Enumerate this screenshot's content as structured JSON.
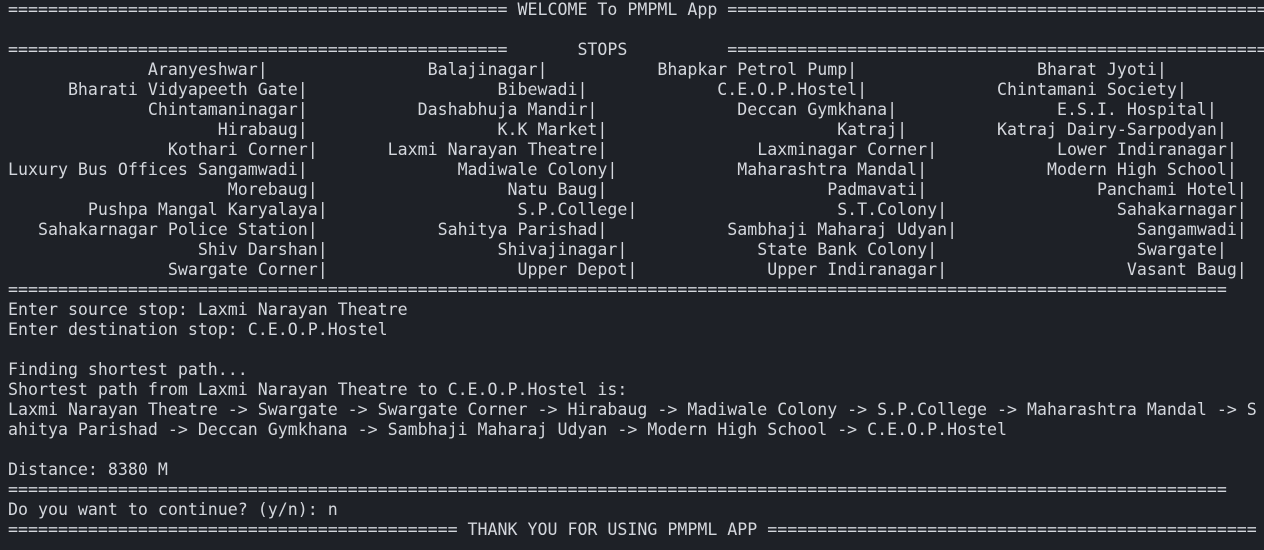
{
  "header": {
    "welcome_banner": "================================================== WELCOME To PMPML App ======================================================",
    "stops_banner": "==================================================       STOPS          ======================================================"
  },
  "stops": {
    "rows": [
      "              Aranyeshwar|                Balajinagar|           Bhapkar Petrol Pump|                  Bharat Jyoti|",
      "      Bharati Vidyapeeth Gate|                   Bibewadi|             C.E.O.P.Hostel|             Chintamani Society|",
      "              Chintamaninagar|           Dashabhuja Mandir|              Deccan Gymkhana|                E.S.I. Hospital|",
      "                     Hirabaug|                   K.K Market|                       Katraj|         Katraj Dairy-Sarpodyan|",
      "                Kothari Corner|       Laxmi Narayan Theatre|               Laxminagar Corner|            Lower Indiranagar|",
      "Luxury Bus Offices Sangamwadi|               Madiwale Colony|            Maharashtra Mandal|            Modern High School|",
      "                      Morebaug|                   Natu Baug|                      Padmavati|                 Panchami Hotel|",
      "        Pushpa Mangal Karyalaya|                   S.P.College|                    S.T.Colony|                 Sahakarnagar|",
      "   Sahakarnagar Police Station|            Sahitya Parishad|            Sambhaji Maharaj Udyan|                  Sangamwadi|",
      "                   Shiv Darshan|                 Shivajinagar|             State Bank Colony|                    Swargate|",
      "                Swargate Corner|                   Upper Depot|             Upper Indiranagar|                  Vasant Baug|"
    ],
    "footer_rule": "=========================================================================================================================="
  },
  "session": {
    "source_prompt": "Enter source stop: Laxmi Narayan Theatre",
    "destination_prompt": "Enter destination stop: C.E.O.P.Hostel",
    "blank1": "",
    "finding": "Finding shortest path...",
    "result_heading": "Shortest path from Laxmi Narayan Theatre to C.E.O.P.Hostel is:",
    "path_line1": "Laxmi Narayan Theatre -> Swargate -> Swargate Corner -> Hirabaug -> Madiwale Colony -> S.P.College -> Maharashtra Mandal -> S",
    "path_line2": "ahitya Parishad -> Deccan Gymkhana -> Sambhaji Maharaj Udyan -> Modern High School -> C.E.O.P.Hostel",
    "blank2": "",
    "distance": "Distance: 8380 M",
    "rule": "==========================================================================================================================",
    "continue_prompt": "Do you want to continue? (y/n): n",
    "thank_you_banner": "============================================= THANK YOU FOR USING PMPML APP ================================================="
  }
}
